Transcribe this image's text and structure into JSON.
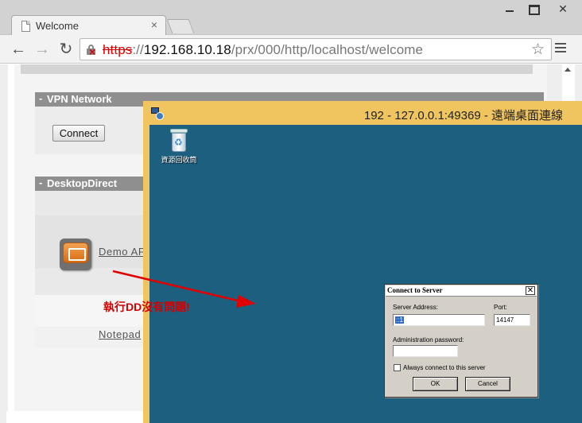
{
  "browser": {
    "tab_title": "Welcome",
    "tab_close": "×",
    "url_scheme": "https",
    "url_sep": "://",
    "url_host": "192.168.10.18",
    "url_path": "/prx/000/http/localhost/welcome",
    "icons": [
      "back-icon",
      "forward-icon",
      "reload-icon",
      "lock-broken-icon",
      "star-icon",
      "menu-icon",
      "page-icon"
    ]
  },
  "window": {
    "close_glyph": "✕"
  },
  "page": {
    "vpn_section": {
      "title": "VPN Network",
      "connect_label": "Connect"
    },
    "dd_section": {
      "title": "DesktopDirect",
      "apps": [
        {
          "label": "Demo AP"
        },
        {
          "label": "Notepad"
        }
      ]
    }
  },
  "remote": {
    "title": "192 - 127.0.0.1:49369 - 遠端桌面連線",
    "recycle_bin_label": "資源回收筒",
    "desktop_color": "#1d5f7f",
    "titlebar_color": "#f0c560"
  },
  "dialog": {
    "title": "Connect to Server",
    "close_glyph": "✕",
    "server_address_label": "Server Address:",
    "server_address_value": "::1",
    "port_label": "Port:",
    "port_value": "14147",
    "admin_password_label": "Administration password:",
    "always_connect_label": "Always connect to this server",
    "ok_label": "OK",
    "cancel_label": "Cancel"
  },
  "annotation": {
    "text": "執行DD沒有問題!",
    "color": "#d40000"
  }
}
